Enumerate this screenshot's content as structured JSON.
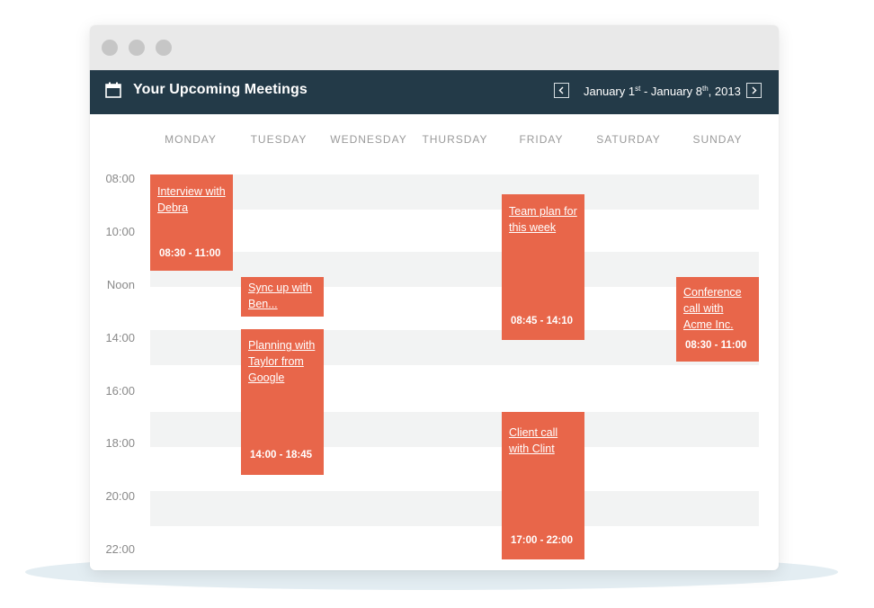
{
  "header": {
    "title": "Your Upcoming Meetings",
    "date_range": {
      "start_month_day": "January 1",
      "start_suffix": "st",
      "separator": " - January 8",
      "end_suffix": "th",
      "year": ", 2013"
    },
    "icons": {
      "calendar": "calendar-icon",
      "prev": "chevron-left-icon",
      "next": "chevron-right-icon"
    }
  },
  "days": [
    "MONDAY",
    "TUESDAY",
    "WEDNESDAY",
    "THURSDAY",
    "FRIDAY",
    "SATURDAY",
    "SUNDAY"
  ],
  "times": [
    "08:00",
    "10:00",
    "Noon",
    "14:00",
    "16:00",
    "18:00",
    "20:00",
    "22:00"
  ],
  "events": [
    {
      "day": "MONDAY",
      "title": "Interview with Debra",
      "time": "08:30 - 11:00"
    },
    {
      "day": "TUESDAY",
      "title": "Sync up with Ben...",
      "time": ""
    },
    {
      "day": "TUESDAY",
      "title": "Planning with Taylor from Google",
      "time": "14:00 - 18:45"
    },
    {
      "day": "FRIDAY",
      "title": "Team plan for this week",
      "time": "08:45 - 14:10"
    },
    {
      "day": "FRIDAY",
      "title": "Client call with Clint",
      "time": "17:00 - 22:00"
    },
    {
      "day": "SUNDAY",
      "title": "Conference call with Acme Inc.",
      "time": "08:30 - 11:00"
    }
  ],
  "colors": {
    "header_bg": "#233a48",
    "event": "#e8664a",
    "band": "#f2f3f3",
    "chrome": "#e9e9e9",
    "chrome_dot": "#c6c6c6"
  }
}
